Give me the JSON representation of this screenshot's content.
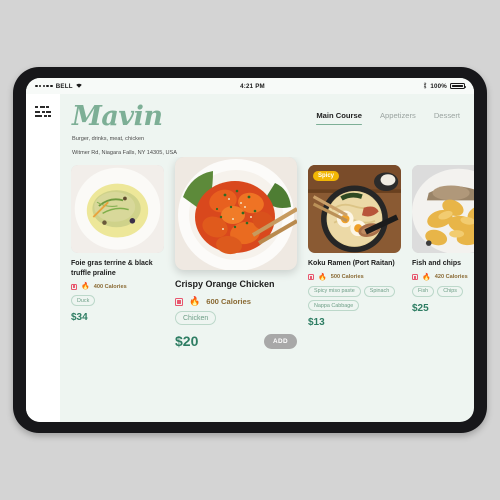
{
  "status_bar": {
    "carrier": "BELL",
    "wifi_icon": "wifi-icon",
    "time": "4:21 PM",
    "bluetooth_icon": "bluetooth-icon",
    "battery_percent": "100%"
  },
  "sidebar": {
    "menu_icon": "hamburger-menu-icon"
  },
  "header": {
    "brand": "Mavin",
    "subtitle": "Burger, drinks, meat, chicken",
    "address": "Witmer Rd, Niagara Falls, NY 14305, USA"
  },
  "tabs": [
    {
      "label": "Main Course",
      "active": true
    },
    {
      "label": "Appetizers",
      "active": false
    },
    {
      "label": "Dessert",
      "active": false
    }
  ],
  "colors": {
    "brand_green": "#7daf96",
    "price_green": "#2e7d63",
    "tag_green": "#6d9e86",
    "spicy_yellow": "#f2b705",
    "calorie_brown": "#8a6a34",
    "add_gray": "#a8a8a8",
    "screen_bg": "#eef5f1",
    "sidebar_bg": "#ffffff"
  },
  "cards": [
    {
      "title": "Foie gras terrine & black truffle praline",
      "calories": "400 Calories",
      "tags": [
        "Duck"
      ],
      "price": "$34",
      "badge": null,
      "featured": false
    },
    {
      "title": "Crispy Orange Chicken",
      "calories": "600 Calories",
      "tags": [
        "Chicken"
      ],
      "price": "$20",
      "badge": null,
      "featured": true,
      "add_label": "ADD"
    },
    {
      "title": "Koku Ramen (Port  Raitan)",
      "calories": "500 Calories",
      "tags": [
        "Spicy miso paste",
        "Spinach",
        "Nappa Cabbage"
      ],
      "price": "$13",
      "badge": "Spicy",
      "featured": false
    },
    {
      "title": "Fish and chips",
      "calories": "420 Calories",
      "tags": [
        "Fish",
        "Chips"
      ],
      "price": "$25",
      "badge": null,
      "featured": false
    }
  ]
}
